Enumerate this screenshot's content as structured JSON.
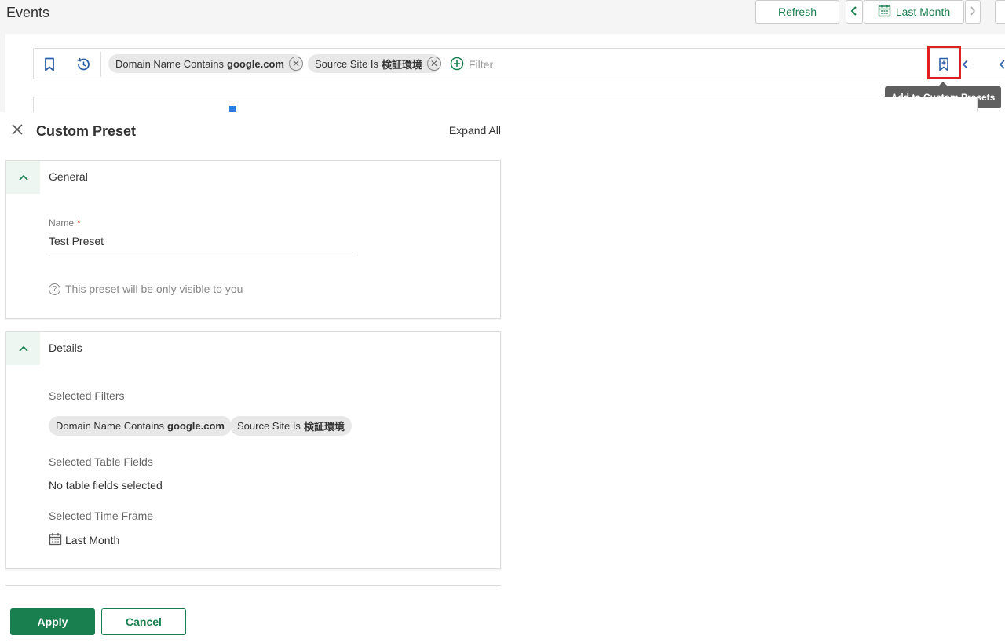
{
  "header": {
    "title": "Events",
    "refresh_label": "Refresh",
    "timeframe_label": "Last Month"
  },
  "filter_bar": {
    "chips": [
      {
        "prefix": "Domain Name Contains",
        "value": "google.com"
      },
      {
        "prefix": "Source Site Is",
        "value": "検証環境"
      }
    ],
    "add_filter_label": "Filter"
  },
  "tooltip": {
    "text": "Add to Custom Presets"
  },
  "drawer": {
    "title": "Custom Preset",
    "expand_all_label": "Expand All",
    "general": {
      "heading": "General",
      "name_label": "Name",
      "required_marker": "*",
      "name_value": "Test Preset",
      "hint": "This preset will be only visible to you",
      "hint_icon": "?"
    },
    "details": {
      "heading": "Details",
      "filters_label": "Selected Filters",
      "filters": [
        {
          "prefix": "Domain Name Contains",
          "value": "google.com"
        },
        {
          "prefix": "Source Site Is",
          "value": "検証環境"
        }
      ],
      "table_fields_label": "Selected Table Fields",
      "table_fields_value": "No table fields selected",
      "timeframe_label": "Selected Time Frame",
      "timeframe_value": "Last Month"
    },
    "apply_label": "Apply",
    "cancel_label": "Cancel"
  },
  "colors": {
    "accent": "#1a7f4e",
    "highlight": "#e02020",
    "tooltip_bg": "#5f5f5f"
  },
  "icons": {
    "bookmark": "bookmark-icon",
    "history": "history-icon",
    "calendar": "calendar-icon",
    "add_preset": "bookmark-plus-icon",
    "close": "close-icon",
    "chevron_up": "chevron-up-icon"
  }
}
